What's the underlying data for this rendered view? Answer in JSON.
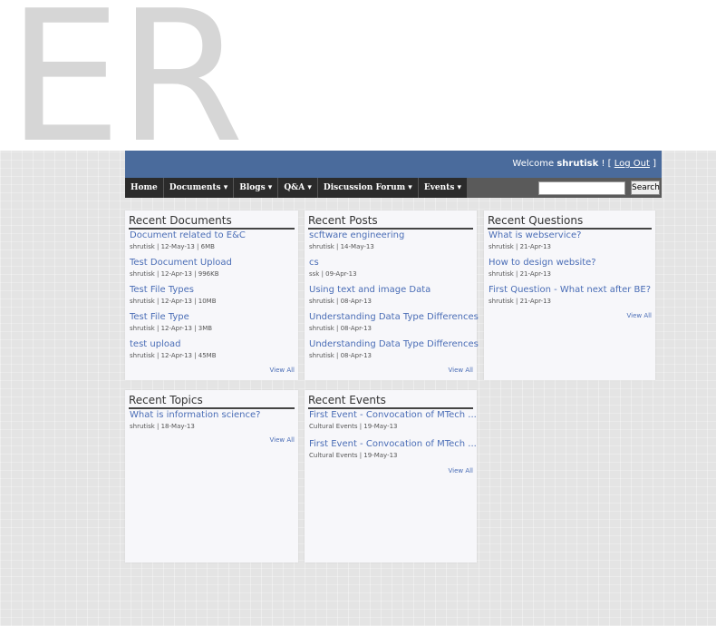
{
  "logo": {
    "text": "ER"
  },
  "header": {
    "welcome_prefix": "Welcome ",
    "username": "shrutisk",
    "separator": " ! [ ",
    "logout": "Log Out",
    "suffix": " ]"
  },
  "nav": {
    "items": [
      {
        "label": "Home"
      },
      {
        "label": "Documents ▾"
      },
      {
        "label": "Blogs ▾"
      },
      {
        "label": "Q&A ▾"
      },
      {
        "label": "Discussion Forum ▾"
      },
      {
        "label": "Events ▾"
      }
    ],
    "search_value": "",
    "search_button": "Search"
  },
  "panels": {
    "documents": {
      "title": "Recent Documents",
      "view_all": "View All",
      "items": [
        {
          "title": "Document related to E&C",
          "meta": "shrutisk | 12-May-13 | 6MB"
        },
        {
          "title": "Test Document Upload",
          "meta": "shrutisk | 12-Apr-13 | 996KB"
        },
        {
          "title": "Test File Types",
          "meta": "shrutisk | 12-Apr-13 | 10MB"
        },
        {
          "title": "Test File Type",
          "meta": "shrutisk | 12-Apr-13 | 3MB"
        },
        {
          "title": "test upload",
          "meta": "shrutisk | 12-Apr-13 | 45MB"
        }
      ]
    },
    "posts": {
      "title": "Recent Posts",
      "view_all": "View All",
      "items": [
        {
          "title": "scftware engineering",
          "meta": "shrutisk | 14-May-13"
        },
        {
          "title": "cs",
          "meta": "ssk | 09-Apr-13"
        },
        {
          "title": "Using text and image Data",
          "meta": "shrutisk | 08-Apr-13"
        },
        {
          "title": "Understanding Data Type Differences",
          "meta": "shrutisk | 08-Apr-13"
        },
        {
          "title": "Understanding Data Type Differences",
          "meta": "shrutisk | 08-Apr-13"
        }
      ]
    },
    "questions": {
      "title": "Recent Questions",
      "view_all": "View All",
      "items": [
        {
          "title": "What is webservice?",
          "meta": "shrutisk | 21-Apr-13"
        },
        {
          "title": "How to design website?",
          "meta": "shrutisk | 21-Apr-13"
        },
        {
          "title": "First Question - What next after BE?",
          "meta": "shrutisk | 21-Apr-13"
        }
      ]
    },
    "topics": {
      "title": "Recent Topics",
      "view_all": "View All",
      "items": [
        {
          "title": "What is information science?",
          "meta": "shrutisk | 18-May-13"
        }
      ]
    },
    "events": {
      "title": "Recent Events",
      "view_all": "View All",
      "items": [
        {
          "title": "First Event - Convocation of MTech ...",
          "meta": "Cultural Events | 19-May-13"
        },
        {
          "title": "First Event - Convocation of MTech ...",
          "meta": "Cultural Events | 19-May-13"
        }
      ]
    }
  }
}
